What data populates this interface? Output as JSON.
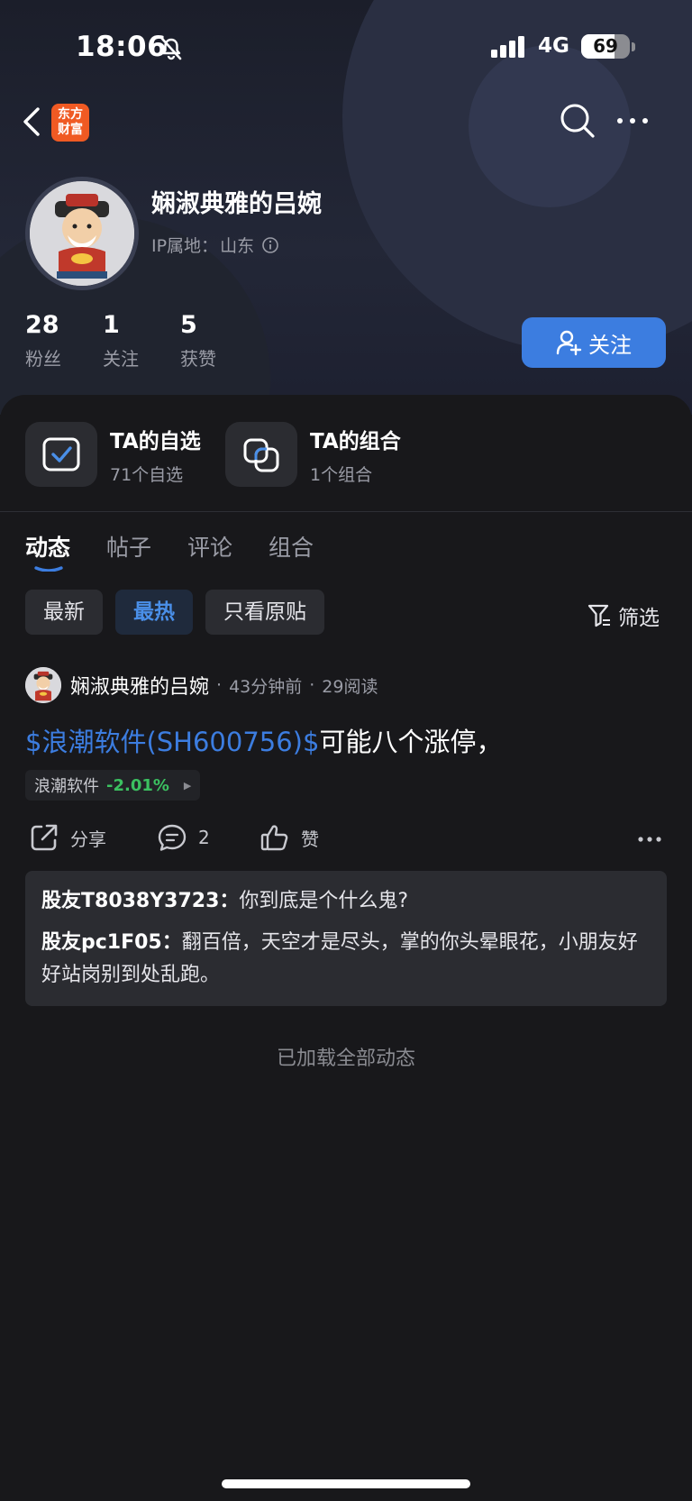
{
  "status_bar": {
    "time": "18:06",
    "network": "4G",
    "battery_level": "69",
    "battery_fraction": 0.69
  },
  "nav": {
    "logo_line1": "东方",
    "logo_line2": "财富",
    "logo_color": "#f05a23"
  },
  "profile": {
    "username": "娴淑典雅的吕婉",
    "ip_label": "IP属地：",
    "ip_value": "山东",
    "stats": [
      {
        "num": "28",
        "label": "粉丝"
      },
      {
        "num": "1",
        "label": "关注"
      },
      {
        "num": "5",
        "label": "获赞"
      }
    ],
    "follow_label": "关注",
    "accent_color": "#3c7de0"
  },
  "cards": [
    {
      "title": "TA的自选",
      "sub": "71个自选"
    },
    {
      "title": "TA的组合",
      "sub": "1个组合"
    }
  ],
  "tabs": [
    "动态",
    "帖子",
    "评论",
    "组合"
  ],
  "filters": [
    "最新",
    "最热",
    "只看原贴"
  ],
  "filter_label": "筛选",
  "post": {
    "author": "娴淑典雅的吕婉",
    "time": "43分钟前",
    "reads": "29阅读",
    "link_text": "$浪潮软件(SH600756)$",
    "body_text": "可能八个涨停，",
    "stock_name": "浪潮软件",
    "stock_change": "-2.01%",
    "share_label": "分享",
    "comment_count": "2",
    "like_label": "赞",
    "comments": [
      {
        "user": "股友T8038Y3723：",
        "text": "你到底是个什么鬼?"
      },
      {
        "user": "股友pc1F05：",
        "text": "翻百倍，天空才是尽头，掌的你头晕眼花，小朋友好好站岗别到处乱跑。"
      }
    ]
  },
  "end_text": "已加载全部动态"
}
